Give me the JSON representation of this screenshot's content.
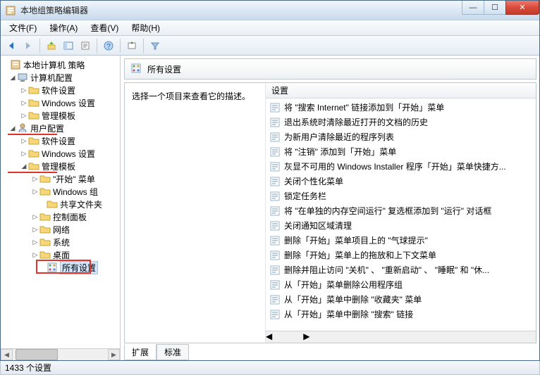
{
  "window": {
    "title": "本地组策略编辑器"
  },
  "menu": {
    "file": "文件(F)",
    "action": "操作(A)",
    "view": "查看(V)",
    "help": "帮助(H)"
  },
  "tree": {
    "root": "本地计算机 策略",
    "computer_cfg": "计算机配置",
    "software_settings": "软件设置",
    "windows_settings": "Windows 设置",
    "admin_templates": "管理模板",
    "user_cfg": "用户配置",
    "start_menu": "\"开始\" 菜单",
    "windows_comp": "Windows 组",
    "shared_folders": "共享文件夹",
    "control_panel": "控制面板",
    "network": "网络",
    "system": "系统",
    "desktop": "桌面",
    "all_settings": "所有设置"
  },
  "right": {
    "header": "所有设置",
    "hint": "选择一个项目来查看它的描述。",
    "col_setting": "设置",
    "items": [
      "将 \"搜索 Internet\" 链接添加到「开始」菜单",
      "退出系统时清除最近打开的文档的历史",
      "为新用户清除最近的程序列表",
      "将 \"注销\" 添加到「开始」菜单",
      "灰显不可用的 Windows Installer 程序「开始」菜单快捷方...",
      "关闭个性化菜单",
      "锁定任务栏",
      "将 \"在单独的内存空间运行\" 复选框添加到 \"运行\" 对话框",
      "关闭通知区域清理",
      "删除「开始」菜单项目上的 \"气球提示\"",
      "删除「开始」菜单上的拖放和上下文菜单",
      "删除并阻止访问 \"关机\" 、 \"重新启动\" 、 \"睡眠\" 和 \"休...",
      "从「开始」菜单删除公用程序组",
      "从「开始」菜单中删除 \"收藏夹\" 菜单",
      "从「开始」菜单中删除 \"搜索\" 链接"
    ]
  },
  "tabs": {
    "extended": "扩展",
    "standard": "标准"
  },
  "status": {
    "count": "1433 个设置"
  }
}
